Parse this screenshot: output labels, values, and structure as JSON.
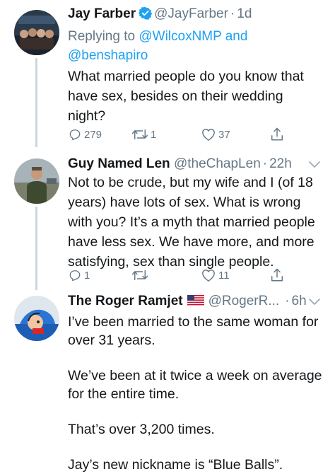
{
  "tweets": [
    {
      "name": "Jay Farber",
      "handle": "@JayFarber",
      "separator": "·",
      "time": "1d",
      "verified": true,
      "replying_prefix": "Replying to",
      "replying_user1": "@WilcoxNMP",
      "replying_and": "and",
      "replying_user2": "@benshapiro",
      "lines": [
        "What married people do you know that",
        "have sex, besides on their wedding",
        "night?"
      ],
      "replies": "279",
      "retweets": "1",
      "likes": "37"
    },
    {
      "name": "Guy Named Len",
      "handle": "@theChapLen",
      "separator": "·",
      "time": "22h",
      "lines": [
        "Not to be crude, but my wife and I (of 18",
        "years) have lots of sex. What is wrong",
        "with you? It’s a myth that married people",
        "have less sex. We have more, and more",
        "satisfying, sex than single people."
      ],
      "replies": "1",
      "retweets": "",
      "likes": "11"
    },
    {
      "name": "The Roger Ramjet",
      "handle": "@RogerR...",
      "separator": "·",
      "time": "6h",
      "lines": [
        "I’ve been married to the same woman for",
        "over 31 years.",
        "",
        "We’ve been at it twice a week on average",
        "for the entire time.",
        "",
        "That’s over 3,200 times.",
        "",
        "Jay’s new nickname is “Blue Balls”."
      ]
    }
  ],
  "icons": {
    "reply": "reply-icon",
    "retweet": "retweet-icon",
    "like": "like-icon",
    "share": "share-icon",
    "verified": "verified-badge-icon",
    "chevron": "chevron-down-icon",
    "flag": "us-flag-icon"
  },
  "colors": {
    "text": "#14171a",
    "secondary": "#657786",
    "link": "#1da1f2",
    "thread_line": "#ccd6dd"
  }
}
